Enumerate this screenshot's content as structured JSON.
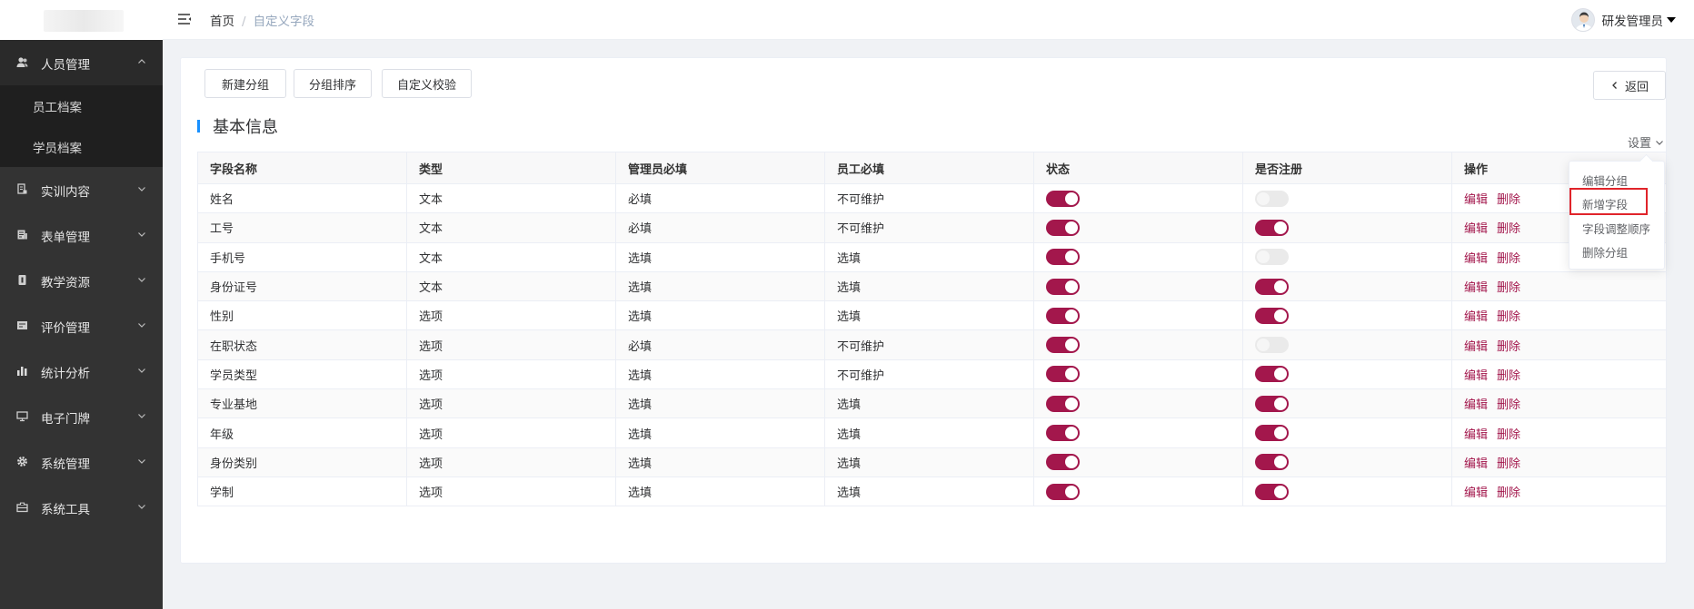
{
  "header": {
    "breadcrumb_home": "首页",
    "breadcrumb_separator": "/",
    "breadcrumb_current": "自定义字段",
    "user_name": "研发管理员"
  },
  "sidebar": {
    "open_menu": {
      "label": "人员管理",
      "icon": "people-icon"
    },
    "sub_items": [
      "员工档案",
      "学员档案"
    ],
    "items": [
      {
        "label": "实训内容",
        "icon": "document-icon"
      },
      {
        "label": "表单管理",
        "icon": "form-icon"
      },
      {
        "label": "教学资源",
        "icon": "book-icon"
      },
      {
        "label": "评价管理",
        "icon": "evaluation-icon"
      },
      {
        "label": "统计分析",
        "icon": "bar-chart-icon"
      },
      {
        "label": "电子门牌",
        "icon": "monitor-icon"
      },
      {
        "label": "系统管理",
        "icon": "gear-icon"
      },
      {
        "label": "系统工具",
        "icon": "toolbox-icon"
      }
    ]
  },
  "toolbar": {
    "new_group": "新建分组",
    "group_sort": "分组排序",
    "custom_validate": "自定义校验",
    "back": "返回"
  },
  "section": {
    "title": "基本信息",
    "settings_label": "设置"
  },
  "table": {
    "headers": [
      "字段名称",
      "类型",
      "管理员必填",
      "员工必填",
      "状态",
      "是否注册",
      "操作"
    ],
    "edit_label": "编辑",
    "delete_label": "删除",
    "rows": [
      {
        "name": "姓名",
        "type": "文本",
        "admin_required": "必填",
        "staff_required": "不可维护",
        "status_on": true,
        "register_on": false
      },
      {
        "name": "工号",
        "type": "文本",
        "admin_required": "必填",
        "staff_required": "不可维护",
        "status_on": true,
        "register_on": true
      },
      {
        "name": "手机号",
        "type": "文本",
        "admin_required": "选填",
        "staff_required": "选填",
        "status_on": true,
        "register_on": false
      },
      {
        "name": "身份证号",
        "type": "文本",
        "admin_required": "选填",
        "staff_required": "选填",
        "status_on": true,
        "register_on": true
      },
      {
        "name": "性别",
        "type": "选项",
        "admin_required": "选填",
        "staff_required": "选填",
        "status_on": true,
        "register_on": true
      },
      {
        "name": "在职状态",
        "type": "选项",
        "admin_required": "必填",
        "staff_required": "不可维护",
        "status_on": true,
        "register_on": false
      },
      {
        "name": "学员类型",
        "type": "选项",
        "admin_required": "选填",
        "staff_required": "不可维护",
        "status_on": true,
        "register_on": true
      },
      {
        "name": "专业基地",
        "type": "选项",
        "admin_required": "选填",
        "staff_required": "选填",
        "status_on": true,
        "register_on": true
      },
      {
        "name": "年级",
        "type": "选项",
        "admin_required": "选填",
        "staff_required": "选填",
        "status_on": true,
        "register_on": true
      },
      {
        "name": "身份类别",
        "type": "选项",
        "admin_required": "选填",
        "staff_required": "选填",
        "status_on": true,
        "register_on": true
      },
      {
        "name": "学制",
        "type": "选项",
        "admin_required": "选填",
        "staff_required": "选填",
        "status_on": true,
        "register_on": true
      }
    ]
  },
  "dropdown": {
    "items": [
      "编辑分组",
      "新增字段",
      "字段调整顺序",
      "删除分组"
    ],
    "highlighted": "新增字段"
  },
  "colors": {
    "accent": "#a3174c",
    "sidebar_bg": "#333333",
    "section_bar": "#1890ff",
    "highlight_border": "#e0242a"
  }
}
